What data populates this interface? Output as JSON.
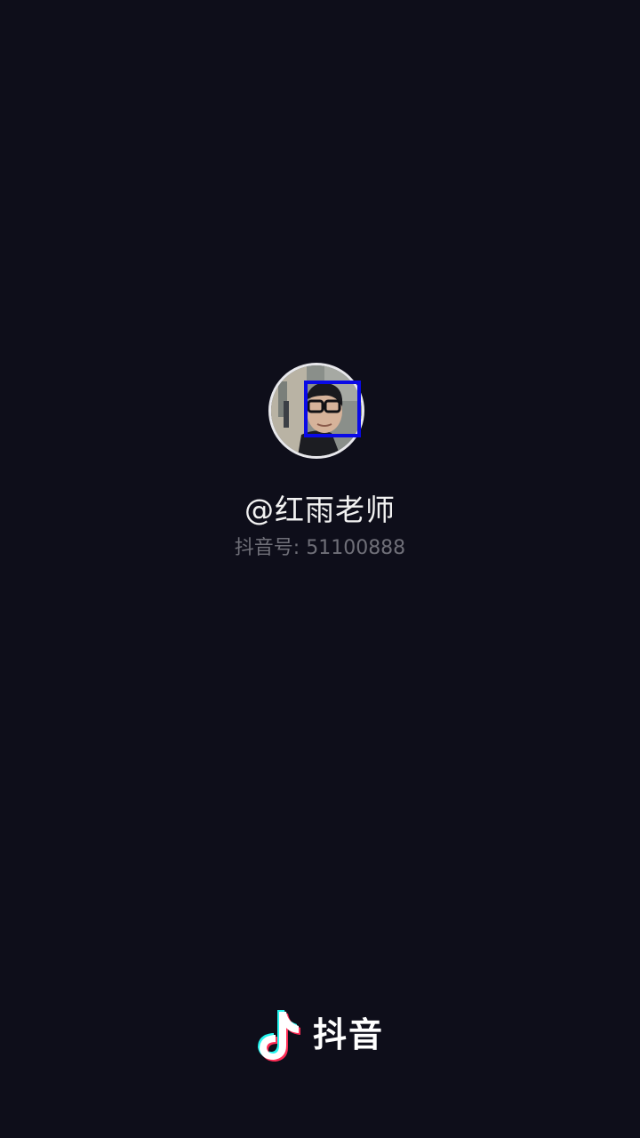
{
  "profile": {
    "username": "@红雨老师",
    "account_id": "抖音号: 51100888",
    "avatar_icon": "avatar-photo",
    "face_box_color": "#0a0ae6"
  },
  "brand": {
    "name": "抖音",
    "logo_icon": "douyin-note-icon",
    "colors": {
      "cyan": "#25f4ee",
      "red": "#fe2c55",
      "white": "#ffffff"
    }
  },
  "background_color": "#0e0e1a"
}
